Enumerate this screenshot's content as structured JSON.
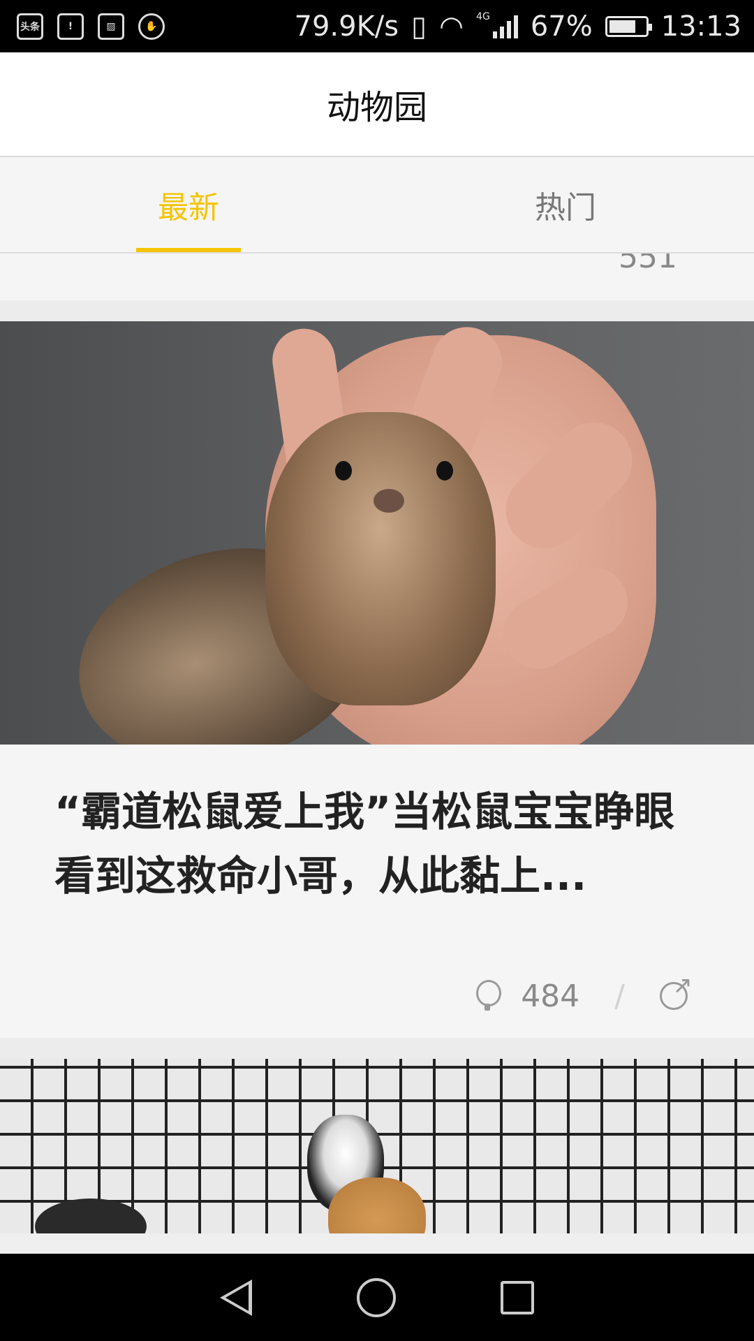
{
  "status_bar": {
    "left_icons": [
      "toutiao-icon",
      "battery-alert-icon",
      "image-icon",
      "hand-icon"
    ],
    "toutiao_text": "头条",
    "speed": "79.9K/s",
    "network": "4G",
    "battery_percent": "67%",
    "battery_level": 0.67,
    "time": "13:13"
  },
  "header": {
    "title": "动物园"
  },
  "tabs": [
    {
      "label": "最新",
      "active": true
    },
    {
      "label": "热门",
      "active": false
    }
  ],
  "feed": {
    "prev_tail": {
      "comment_count": "551"
    },
    "cards": [
      {
        "title": "“霸道松鼠爱上我”当松鼠宝宝睁眼看到这救命小哥，从此黏上...",
        "comment_count": "484"
      }
    ]
  },
  "nav": {
    "back": "back-icon",
    "home": "home-icon",
    "recents": "recents-icon"
  }
}
